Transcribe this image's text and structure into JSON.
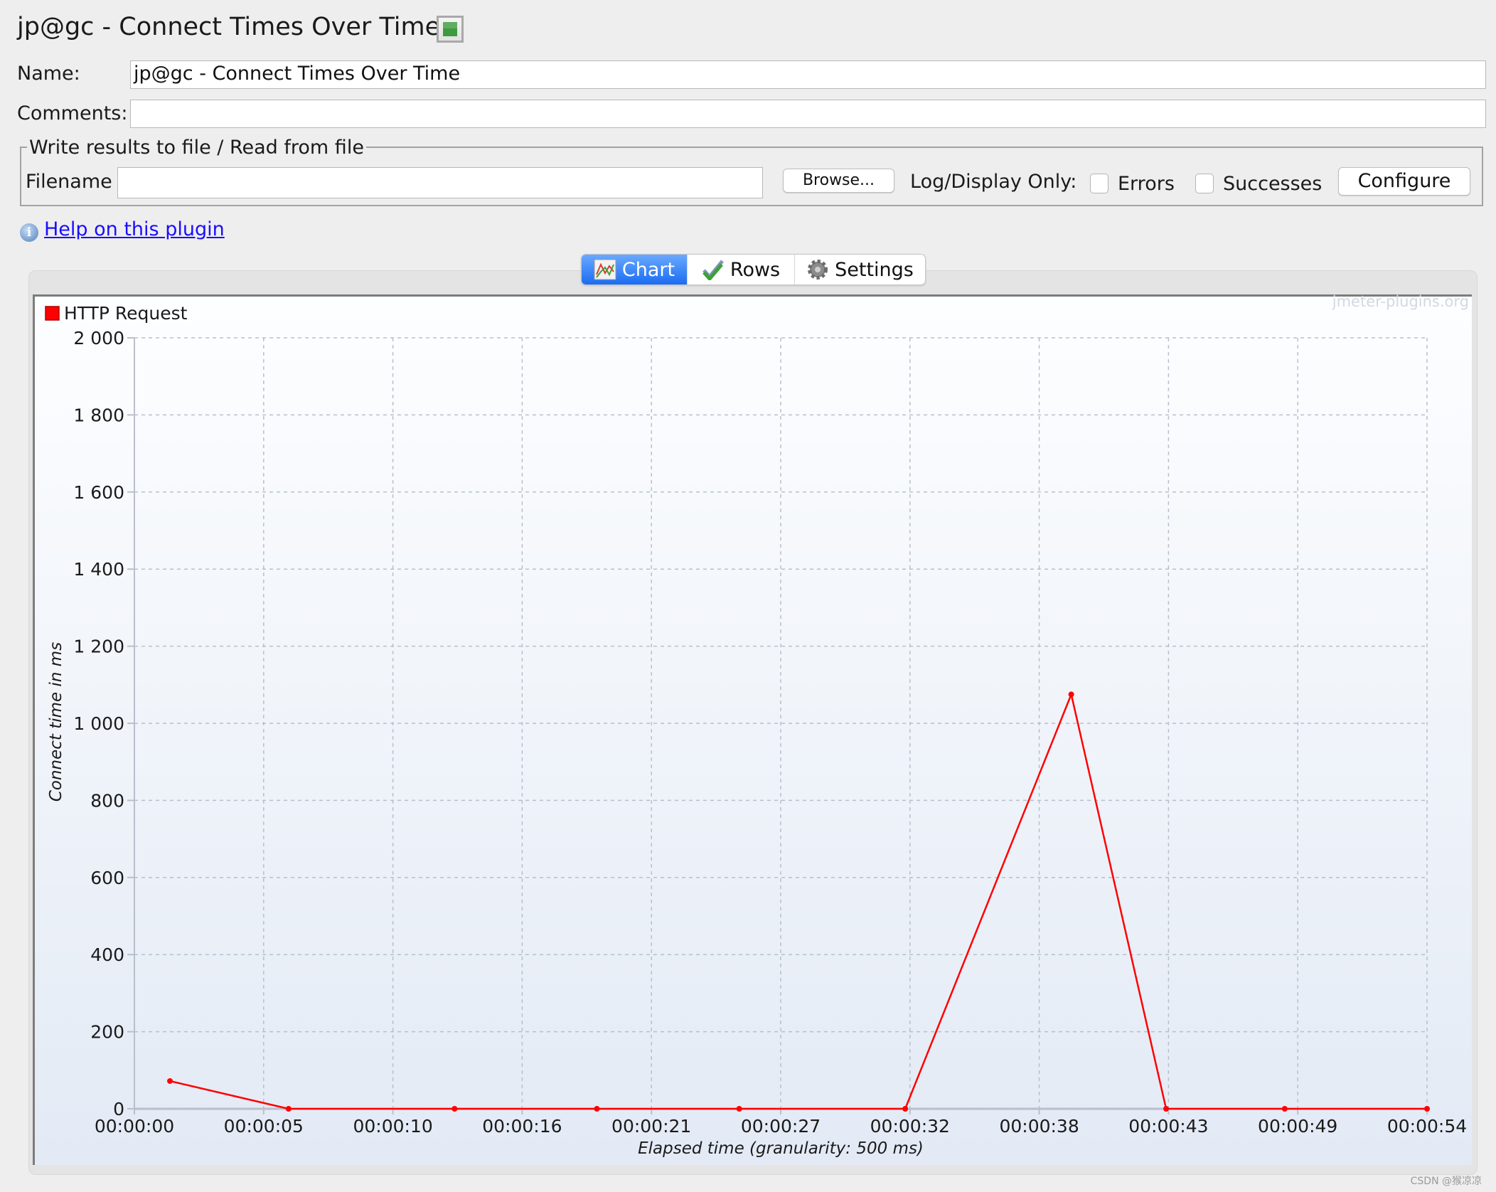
{
  "header": {
    "title": "jp@gc - Connect Times Over Time",
    "title_icon": "expand-arrows-icon"
  },
  "form": {
    "name_label": "Name:",
    "name_value": "jp@gc - Connect Times Over Time",
    "comments_label": "Comments:",
    "comments_value": ""
  },
  "file_section": {
    "legend": "Write results to file / Read from file",
    "filename_label": "Filename",
    "filename_value": "",
    "browse_label": "Browse...",
    "log_display_label": "Log/Display Only:",
    "errors_label": "Errors",
    "errors_checked": false,
    "successes_label": "Successes",
    "successes_checked": false,
    "configure_label": "Configure"
  },
  "help": {
    "icon": "info-icon",
    "link_text": "Help on this plugin"
  },
  "tabs": [
    {
      "label": "Chart",
      "icon": "line-chart-icon",
      "active": true
    },
    {
      "label": "Rows",
      "icon": "checkmark-icon",
      "active": false
    },
    {
      "label": "Settings",
      "icon": "gear-icon",
      "active": false
    }
  ],
  "watermark": "jmeter-plugins.org",
  "footer_credit": "CSDN @猴凉凉",
  "chart_data": {
    "type": "line",
    "title": "",
    "xlabel": "Elapsed time (granularity: 500 ms)",
    "ylabel": "Connect time in ms",
    "xlim": [
      0,
      54.5
    ],
    "ylim": [
      0,
      2000
    ],
    "grid": true,
    "legend_position": "top-left",
    "x_tick_labels": [
      "00:00:00",
      "00:00:05",
      "00:00:10",
      "00:00:16",
      "00:00:21",
      "00:00:27",
      "00:00:32",
      "00:00:38",
      "00:00:43",
      "00:00:49",
      "00:00:54"
    ],
    "y_tick_labels": [
      "0",
      "200",
      "400",
      "600",
      "800",
      "1 000",
      "1 200",
      "1 400",
      "1 600",
      "1 800",
      "2 000"
    ],
    "y_ticks": [
      0,
      200,
      400,
      600,
      800,
      1000,
      1200,
      1400,
      1600,
      1800,
      2000
    ],
    "series": [
      {
        "name": "HTTP Request",
        "color": "#ff0000",
        "x": [
          1.5,
          6.5,
          13.5,
          19.5,
          25.5,
          32.5,
          39.5,
          43.5,
          48.5,
          54.5
        ],
        "values": [
          72,
          0,
          0,
          0,
          0,
          0,
          1075,
          0,
          0,
          0
        ]
      }
    ]
  }
}
